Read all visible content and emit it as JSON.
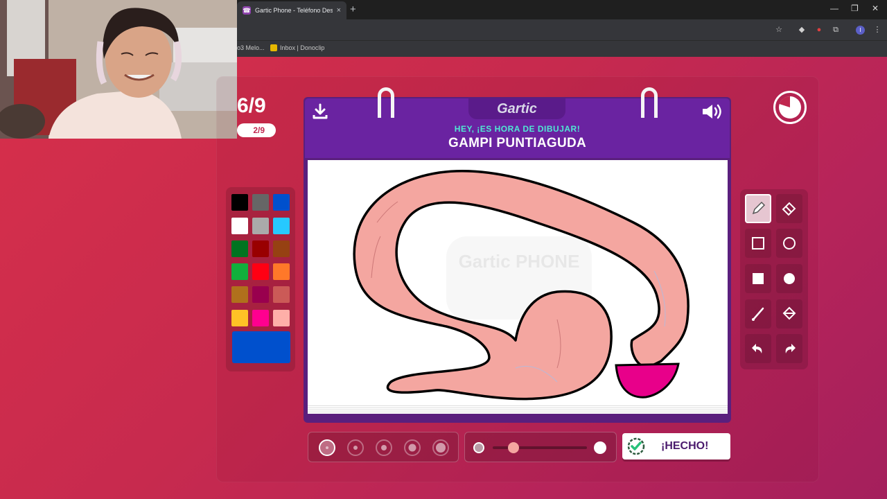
{
  "browser": {
    "tab_title": "Gartic Phone - Teléfono Desco",
    "tab_close": "×",
    "new_tab": "+",
    "bookmarks": [
      "o3 Melo...",
      "Inbox | Donoclip"
    ],
    "profile_initial": "I",
    "window_controls": {
      "minimize": "—",
      "restore": "❐",
      "close": "✕"
    }
  },
  "game": {
    "round": "6/9",
    "sub_counter": "2/9",
    "logo": "Gartic",
    "prompt_header": "HEY, ¡ES HORA DE DIBUJAR!",
    "prompt_word": "GAMPI PUNTIAGUDA",
    "done_label": "¡HECHO!",
    "watermark": "Gartic PHONE",
    "timer_remaining_fraction": 0.8
  },
  "palette": {
    "colors": [
      "#000000",
      "#666666",
      "#0050cd",
      "#ffffff",
      "#aaaaaa",
      "#26c9ff",
      "#017420",
      "#990000",
      "#964112",
      "#11b03c",
      "#ff0013",
      "#ff7829",
      "#b0701c",
      "#99004e",
      "#cb5a57",
      "#ffc126",
      "#ff008f",
      "#feafa8"
    ],
    "selected_color": "#0050cd"
  },
  "tools": [
    {
      "name": "pencil",
      "icon": "pencil-icon",
      "selected": true
    },
    {
      "name": "eraser",
      "icon": "eraser-icon",
      "selected": false
    },
    {
      "name": "rectangle",
      "icon": "rectangle-outline-icon",
      "selected": false
    },
    {
      "name": "ellipse",
      "icon": "ellipse-outline-icon",
      "selected": false
    },
    {
      "name": "filled-rectangle",
      "icon": "rectangle-filled-icon",
      "selected": false
    },
    {
      "name": "filled-ellipse",
      "icon": "ellipse-filled-icon",
      "selected": false
    },
    {
      "name": "line",
      "icon": "line-icon",
      "selected": false
    },
    {
      "name": "bucket",
      "icon": "bucket-fill-icon",
      "selected": false
    },
    {
      "name": "undo",
      "icon": "undo-icon",
      "selected": false
    },
    {
      "name": "redo",
      "icon": "redo-icon",
      "selected": false
    }
  ],
  "brush_sizes": {
    "count": 5,
    "selected_index": 0
  },
  "opacity": {
    "value": 0.1
  },
  "colors": {
    "background": "#c72a4e",
    "book_purple": "#6a23a1",
    "prompt_teal": "#4fe8d4",
    "drawing_pink": "#f4a6a0",
    "drawing_magenta": "#e8008a"
  }
}
